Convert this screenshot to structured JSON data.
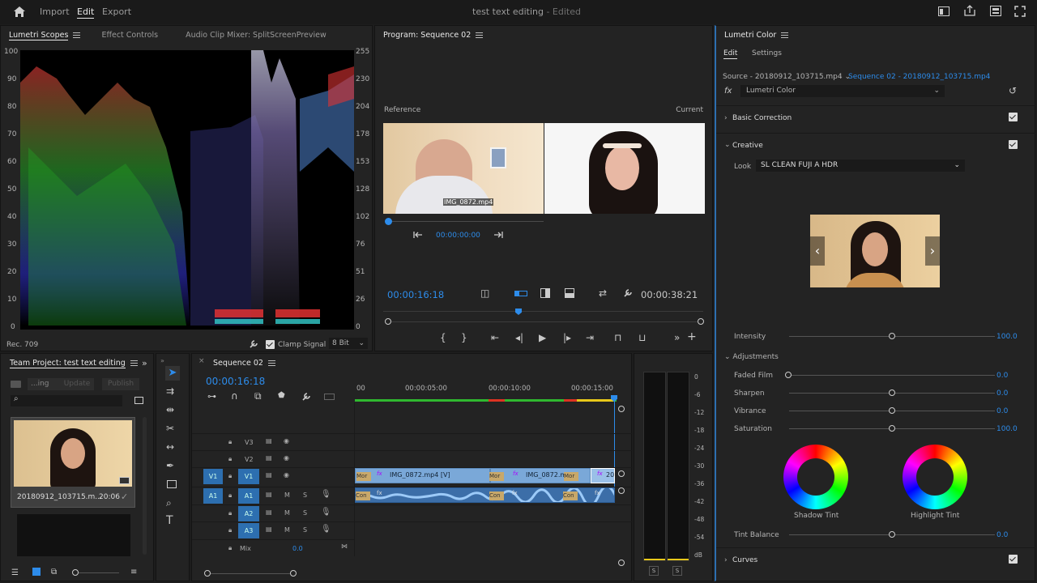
{
  "menubar": {
    "import": "Import",
    "edit": "Edit",
    "export": "Export",
    "title": "test text editing",
    "title_status": "- Edited"
  },
  "scopes": {
    "tabs": [
      "Lumetri Scopes",
      "Effect Controls",
      "Audio Clip Mixer: SplitScreenPreview"
    ],
    "left_scale": [
      "100",
      "90",
      "80",
      "70",
      "60",
      "50",
      "40",
      "30",
      "20",
      "10",
      "0"
    ],
    "right_scale": [
      "255",
      "230",
      "204",
      "178",
      "153",
      "128",
      "102",
      "76",
      "51",
      "26",
      "0"
    ],
    "rec": "Rec. 709",
    "clamp": "Clamp Signal",
    "bit": "8 Bit"
  },
  "program": {
    "title": "Program: Sequence 02",
    "reference": "Reference",
    "current": "Current",
    "ref_time": "00:00:00:00",
    "clip_label": "IMG_0872.mp4",
    "time_left": "00:00:16:18",
    "time_right": "00:00:38:21"
  },
  "lumetri": {
    "title": "Lumetri Color",
    "tabs": [
      "Edit",
      "Settings"
    ],
    "source": "Source - 20180912_103715.mp4",
    "sequence": "Sequence 02 - 20180912_103715.mp4",
    "fx": "fx",
    "effect": "Lumetri Color",
    "basic": "Basic Correction",
    "creative": "Creative",
    "look_label": "Look",
    "look_value": "SL CLEAN FUJI A HDR",
    "intensity_label": "Intensity",
    "intensity": "100.0",
    "adjustments": "Adjustments",
    "sliders": [
      {
        "label": "Faded Film",
        "value": "0.0",
        "pos": 0
      },
      {
        "label": "Sharpen",
        "value": "0.0",
        "pos": 0.5
      },
      {
        "label": "Vibrance",
        "value": "0.0",
        "pos": 0.5
      },
      {
        "label": "Saturation",
        "value": "100.0",
        "pos": 0.5
      }
    ],
    "shadow": "Shadow Tint",
    "highlight": "Highlight Tint",
    "tint_balance": "Tint Balance",
    "tint_value": "0.0",
    "curves": "Curves"
  },
  "project": {
    "title": "Team Project: test text editing",
    "b1": "...ing",
    "b2": "Update",
    "b3": "Publish",
    "clip_name": "20180912_103715.m...",
    "clip_dur": "20:06"
  },
  "timeline": {
    "title": "Sequence 02",
    "timecode": "00:00:16:18",
    "ruler": [
      "00",
      "00:00:05:00",
      "00:00:10:00",
      "00:00:15:00"
    ],
    "tracks": {
      "v3": "V3",
      "v2": "V2",
      "v1": "V1",
      "a1": "A1",
      "a2": "A2",
      "a3": "A3",
      "m": "M",
      "s": "S",
      "mix": "Mix",
      "mix_val": "0.0"
    },
    "clips": {
      "c1": "IMG_0872.mp4 [V]",
      "c2": "IMG_0872.m",
      "c3": "20",
      "mor": "Mor",
      "con": "Con"
    }
  },
  "meter": {
    "scale": [
      "0",
      "-6",
      "-12",
      "-18",
      "-24",
      "-30",
      "-36",
      "-42",
      "-48",
      "-54",
      "dB"
    ],
    "s": "S"
  },
  "colors": {
    "accent": "#2d8ceb",
    "bg": "#232323"
  }
}
